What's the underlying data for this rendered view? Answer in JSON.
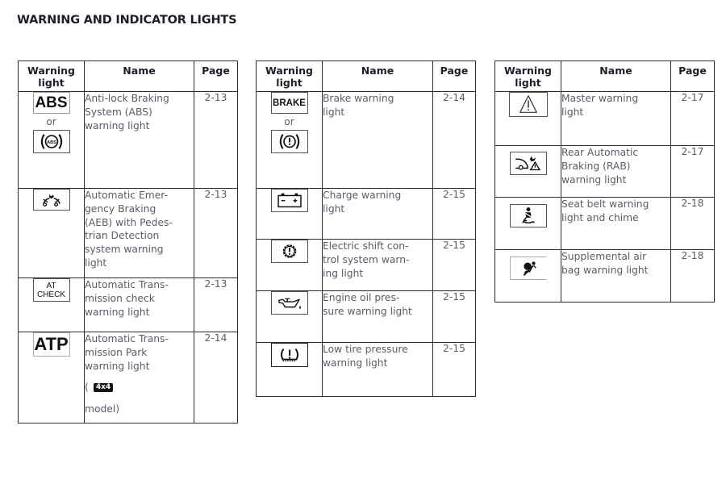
{
  "document": {
    "title": "WARNING AND INDICATOR LIGHTS"
  },
  "headers": {
    "warning_light": "Warning light",
    "name": "Name",
    "page": "Page"
  },
  "tables": [
    {
      "rows": [
        {
          "icons": [
            {
              "type": "text",
              "name": "abs-text-icon",
              "text": "ABS"
            },
            {
              "type": "svg",
              "name": "abs-circle-icon",
              "text": "ABS"
            }
          ],
          "or_label": "or",
          "name": "Anti-lock Braking System (ABS) warning light",
          "page": "2-13"
        },
        {
          "icons": [
            {
              "type": "svg",
              "name": "aeb-pedestrian-icon"
            }
          ],
          "name": "Automatic Emergency Braking (AEB) with Pedestrian Detection system warning light",
          "name_display": "Automatic Emer-\ngency Braking\n(AEB) with Pedes-\ntrian Detection\nsystem warning\nlight",
          "page": "2-13"
        },
        {
          "icons": [
            {
              "type": "text",
              "name": "at-check-icon",
              "text": "AT\nCHECK"
            }
          ],
          "name": "Automatic Transmission check warning light",
          "name_display": "Automatic Trans-\nmission check\nwarning light",
          "page": "2-13"
        },
        {
          "icons": [
            {
              "type": "text",
              "name": "atp-icon",
              "text": "ATP"
            }
          ],
          "name": "Automatic Transmission Park warning light",
          "name_display": "Automatic Trans-\nmission Park\nwarning light",
          "note_prefix": "(",
          "note_badge": "4x4",
          "note_suffix": "model)",
          "page": "2-14"
        }
      ]
    },
    {
      "rows": [
        {
          "icons": [
            {
              "type": "text",
              "name": "brake-text-icon",
              "text": "BRAKE"
            },
            {
              "type": "svg",
              "name": "brake-circle-exclamation-icon"
            }
          ],
          "or_label": "or",
          "name": "Brake warning light",
          "name_display": "Brake warning\nlight",
          "page": "2-14"
        },
        {
          "icons": [
            {
              "type": "svg",
              "name": "battery-charge-icon"
            }
          ],
          "name": "Charge warning light",
          "name_display": "Charge warning\nlight",
          "page": "2-15"
        },
        {
          "icons": [
            {
              "type": "svg",
              "name": "electric-shift-gear-icon"
            }
          ],
          "name": "Electric shift control system warning light",
          "name_display": "Electric shift con-\ntrol system warn-\ning light",
          "page": "2-15"
        },
        {
          "icons": [
            {
              "type": "svg",
              "name": "oil-can-icon"
            }
          ],
          "name": "Engine oil pressure warning light",
          "name_display": "Engine oil pres-\nsure warning light",
          "page": "2-15"
        },
        {
          "icons": [
            {
              "type": "svg",
              "name": "tire-pressure-icon"
            }
          ],
          "name": "Low tire pressure warning light",
          "name_display": "Low tire pressure\nwarning light",
          "page": "2-15"
        }
      ]
    },
    {
      "rows": [
        {
          "icons": [
            {
              "type": "svg",
              "name": "master-warning-triangle-icon"
            }
          ],
          "name": "Master warning light",
          "name_display": "Master warning\nlight",
          "page": "2-17"
        },
        {
          "icons": [
            {
              "type": "svg",
              "name": "rear-automatic-braking-icon"
            }
          ],
          "name": "Rear Automatic Braking (RAB) warning light",
          "name_display": "Rear Automatic\nBraking (RAB)\nwarning light",
          "page": "2-17"
        },
        {
          "icons": [
            {
              "type": "svg",
              "name": "seat-belt-icon"
            }
          ],
          "name": "Seat belt warning light and chime",
          "name_display": "Seat belt warning\nlight and chime",
          "page": "2-18"
        },
        {
          "icons": [
            {
              "type": "svg",
              "name": "airbag-icon"
            }
          ],
          "name": "Supplemental air bag warning light",
          "name_display": "Supplemental air\nbag warning light",
          "page": "2-18"
        }
      ]
    }
  ]
}
